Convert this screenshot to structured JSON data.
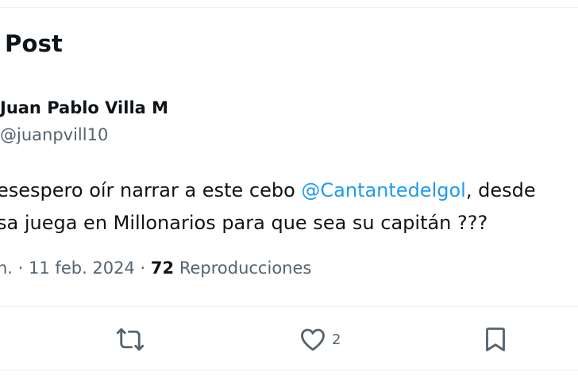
{
  "header": {
    "title": "Post"
  },
  "author": {
    "name": "Juan Pablo Villa M",
    "handle": "@juanpvill10"
  },
  "tweet": {
    "line1_prefix": "esespero oír narrar a este cebo ",
    "mention": "@Cantantedelgol",
    "line1_suffix": ", desde",
    "line2": "sa juega en Millonarios para que sea su capitán ???"
  },
  "meta": {
    "time_fragment": "n.",
    "separator1": " · ",
    "date": "11 feb. 2024",
    "separator2": " · ",
    "views_count": "72",
    "views_label": "Reproducciones"
  },
  "actions": {
    "retweet_icon": "retweet-icon",
    "like_icon": "heart-icon",
    "like_count": "2",
    "bookmark_icon": "bookmark-icon"
  },
  "colors": {
    "accent": "#1d9bf0",
    "secondary_text": "#536471",
    "primary_text": "#0f1419",
    "divider": "#eff3f4"
  }
}
